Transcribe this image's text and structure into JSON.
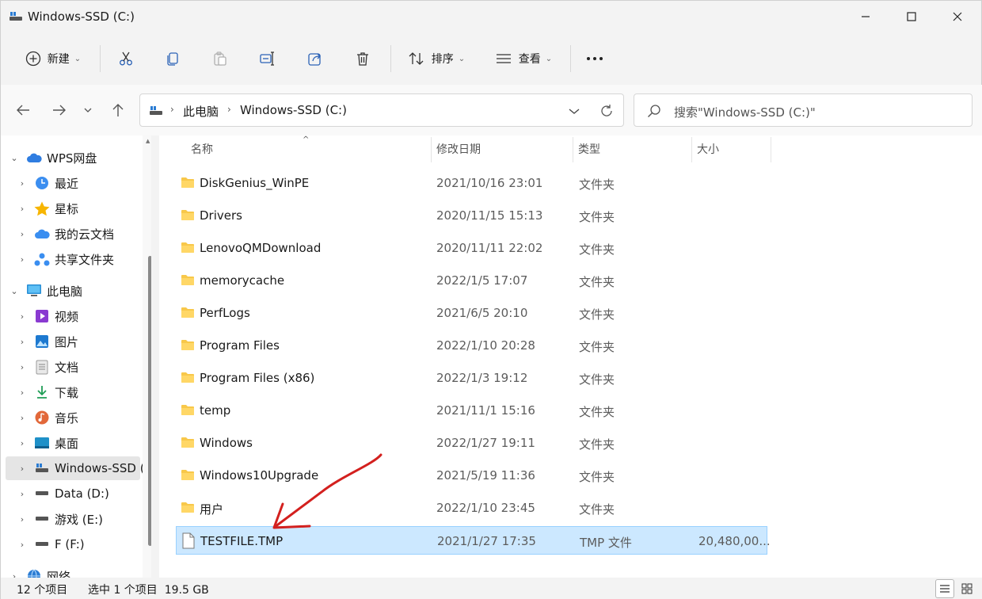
{
  "window": {
    "title": "Windows-SSD (C:)"
  },
  "toolbar": {
    "new_label": "新建",
    "sort_label": "排序",
    "view_label": "查看"
  },
  "address": {
    "crumbs": [
      "此电脑",
      "Windows-SSD (C:)"
    ]
  },
  "search": {
    "placeholder": "搜索\"Windows-SSD (C:)\""
  },
  "sidebar": {
    "items": [
      {
        "label": "WPS网盘",
        "icon": "cloud-icon",
        "expanded": true
      },
      {
        "label": "最近",
        "icon": "clock-icon"
      },
      {
        "label": "星标",
        "icon": "star-icon"
      },
      {
        "label": "我的云文档",
        "icon": "cloud-doc-icon"
      },
      {
        "label": "共享文件夹",
        "icon": "share-icon"
      },
      {
        "label": "此电脑",
        "icon": "computer-icon",
        "expanded": true
      },
      {
        "label": "视频",
        "icon": "video-icon"
      },
      {
        "label": "图片",
        "icon": "picture-icon"
      },
      {
        "label": "文档",
        "icon": "document-icon"
      },
      {
        "label": "下载",
        "icon": "download-icon"
      },
      {
        "label": "音乐",
        "icon": "music-icon"
      },
      {
        "label": "桌面",
        "icon": "desktop-icon"
      },
      {
        "label": "Windows-SSD (",
        "icon": "drive-icon",
        "selected": true
      },
      {
        "label": "Data (D:)",
        "icon": "drive-icon"
      },
      {
        "label": "游戏 (E:)",
        "icon": "drive-icon"
      },
      {
        "label": "F (F:)",
        "icon": "drive-icon"
      },
      {
        "label": "网络",
        "icon": "network-icon"
      }
    ]
  },
  "columns": {
    "name": "名称",
    "modified": "修改日期",
    "type": "类型",
    "size": "大小"
  },
  "files": [
    {
      "name": "DiskGenius_WinPE",
      "modified": "2021/10/16 23:01",
      "type": "文件夹",
      "size": ""
    },
    {
      "name": "Drivers",
      "modified": "2020/11/15 15:13",
      "type": "文件夹",
      "size": ""
    },
    {
      "name": "LenovoQMDownload",
      "modified": "2020/11/11 22:02",
      "type": "文件夹",
      "size": ""
    },
    {
      "name": "memorycache",
      "modified": "2022/1/5 17:07",
      "type": "文件夹",
      "size": ""
    },
    {
      "name": "PerfLogs",
      "modified": "2021/6/5 20:10",
      "type": "文件夹",
      "size": ""
    },
    {
      "name": "Program Files",
      "modified": "2022/1/10 20:28",
      "type": "文件夹",
      "size": ""
    },
    {
      "name": "Program Files (x86)",
      "modified": "2022/1/3 19:12",
      "type": "文件夹",
      "size": ""
    },
    {
      "name": "temp",
      "modified": "2021/11/1 15:16",
      "type": "文件夹",
      "size": ""
    },
    {
      "name": "Windows",
      "modified": "2022/1/27 19:11",
      "type": "文件夹",
      "size": ""
    },
    {
      "name": "Windows10Upgrade",
      "modified": "2021/5/19 11:36",
      "type": "文件夹",
      "size": ""
    },
    {
      "name": "用户",
      "modified": "2022/1/10 23:45",
      "type": "文件夹",
      "size": ""
    },
    {
      "name": "TESTFILE.TMP",
      "modified": "2021/1/27 17:35",
      "type": "TMP 文件",
      "size": "20,480,00...",
      "selected": true
    }
  ],
  "status": {
    "item_count": "12 个项目",
    "selection": "选中 1 个项目  19.5 GB"
  },
  "colors": {
    "selection_bg": "#cce8ff",
    "selection_border": "#99d1ff",
    "folder": "#f8c84a",
    "annotation_arrow": "#d3201e"
  }
}
